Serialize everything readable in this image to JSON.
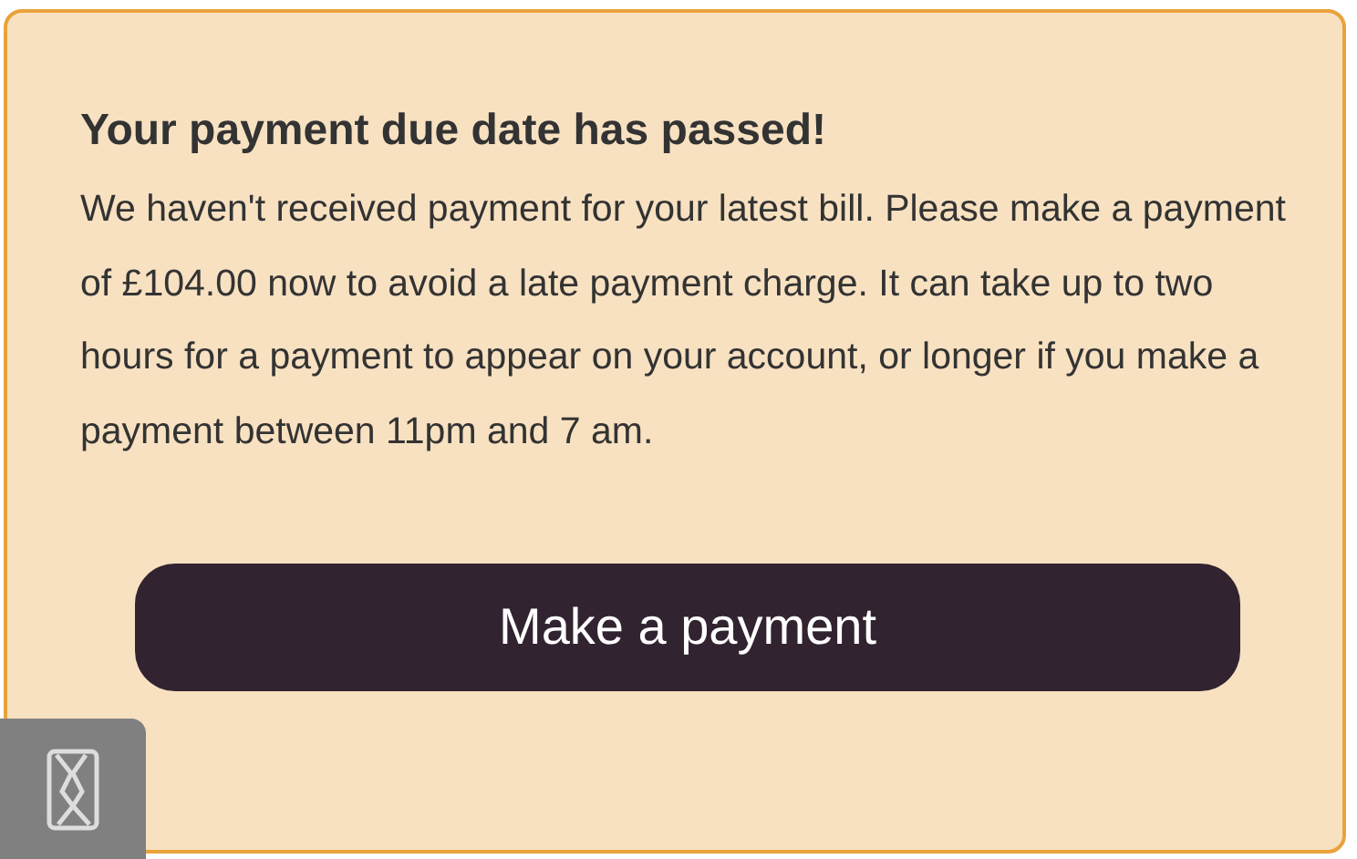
{
  "alert": {
    "title": "Your payment due date has passed!",
    "message": "We haven't received payment for your latest bill. Please make a payment of £104.00 now to avoid a late payment charge. It can take up to two hours for a payment to appear on your account, or longer if you make a payment between 11pm and 7 am.",
    "button": "Make a payment"
  }
}
